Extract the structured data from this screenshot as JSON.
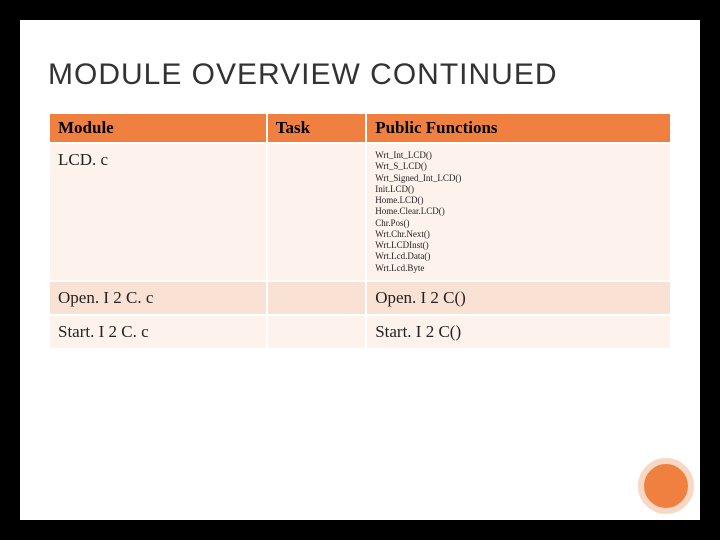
{
  "title": "MODULE OVERVIEW CONTINUED",
  "headers": {
    "module": "Module",
    "task": "Task",
    "functions": "Public Functions"
  },
  "rows": [
    {
      "module": "LCD. c",
      "task": "",
      "functions": "Wrt_Int_LCD()\nWrt_S_LCD()\nWrt_Signed_Int_LCD()\nInit.LCD()\nHome.LCD()\nHome.Clear.LCD()\nChr.Pos()\nWrt.Chr.Next()\nWrt.LCDInst()\nWrt.Lcd.Data()\nWrt.Lcd.Byte"
    },
    {
      "module": "Open. I 2 C. c",
      "task": "",
      "functions": "Open. I 2 C()"
    },
    {
      "module": "Start. I 2 C. c",
      "task": "",
      "functions": "Start. I 2 C()"
    }
  ]
}
